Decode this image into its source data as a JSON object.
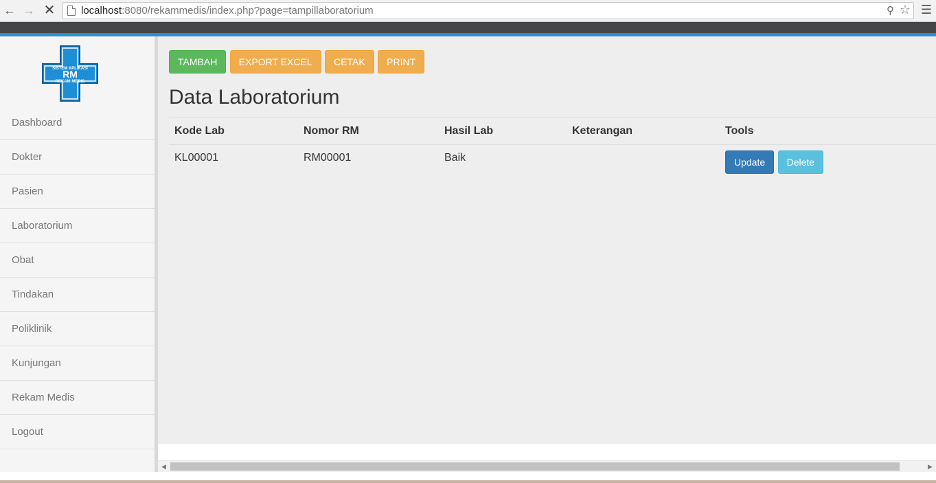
{
  "browser": {
    "url_host": "localhost",
    "url_rest": ":8080/rekammedis/index.php?page=tampillaboratorium"
  },
  "logo": {
    "line1": "SISTEM APLIKASI",
    "line2": "RM",
    "line3": "REKAM MEDIS",
    "color": "#1e8fd6"
  },
  "sidebar": {
    "items": [
      {
        "label": "Dashboard"
      },
      {
        "label": "Dokter"
      },
      {
        "label": "Pasien"
      },
      {
        "label": "Laboratorium"
      },
      {
        "label": "Obat"
      },
      {
        "label": "Tindakan"
      },
      {
        "label": "Poliklinik"
      },
      {
        "label": "Kunjungan"
      },
      {
        "label": "Rekam Medis"
      },
      {
        "label": "Logout"
      }
    ]
  },
  "toolbar": {
    "tambah": "TAMBAH",
    "export_excel": "EXPORT EXCEL",
    "cetak": "CETAK",
    "print": "PRINT"
  },
  "page": {
    "title": "Data Laboratorium"
  },
  "table": {
    "headers": [
      "Kode Lab",
      "Nomor RM",
      "Hasil Lab",
      "Keterangan",
      "Tools"
    ],
    "rows": [
      {
        "kode_lab": "KL00001",
        "nomor_rm": "RM00001",
        "hasil_lab": "Baik",
        "keterangan": "",
        "update": "Update",
        "delete": "Delete"
      }
    ]
  },
  "colors": {
    "accent": "#2a8fce",
    "success": "#5cb85c",
    "warning": "#f0ad4e",
    "primary": "#337ab7",
    "info": "#5bc0de"
  }
}
